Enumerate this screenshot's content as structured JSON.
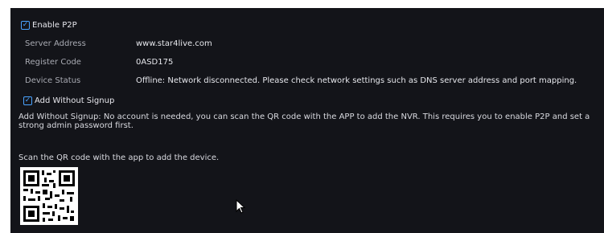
{
  "p2p": {
    "enable_label": "Enable P2P",
    "enabled": true
  },
  "fields": [
    {
      "label": "Server Address",
      "value": "www.star4live.com"
    },
    {
      "label": "Register Code",
      "value": "0ASD175"
    },
    {
      "label": "Device Status",
      "value": "Offline: Network disconnected. Please check network settings such as DNS server address and port mapping."
    }
  ],
  "signup": {
    "label": "Add Without Signup",
    "enabled": true,
    "description": "Add Without Signup: No account is needed, you can scan the QR code with the APP to add the NVR. This requires you to enable P2P and set a strong admin password first."
  },
  "qr": {
    "caption": "Scan the QR code with the app to add the device."
  },
  "icons": {
    "checkbox": "checkmark-icon",
    "pointer": "mouse-pointer-icon"
  },
  "colors": {
    "background": "#131419",
    "accent": "#4aa3ff"
  }
}
